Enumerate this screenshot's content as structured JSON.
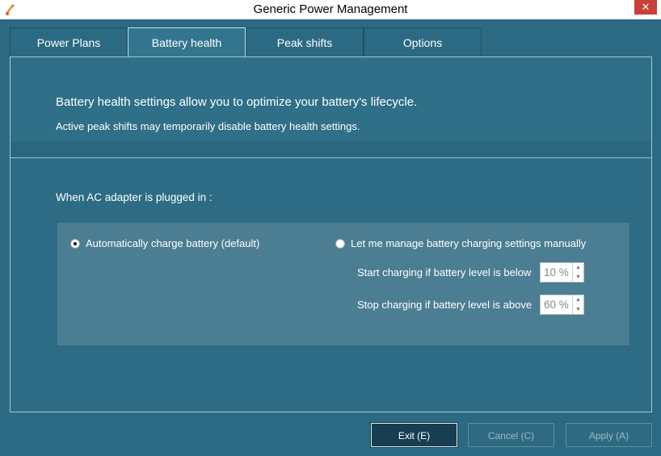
{
  "window": {
    "title": "Generic Power Management",
    "close_glyph": "✕"
  },
  "tabs": [
    {
      "label": "Power Plans"
    },
    {
      "label": "Battery health"
    },
    {
      "label": "Peak shifts"
    },
    {
      "label": "Options"
    }
  ],
  "info": {
    "line1": "Battery health settings allow you to optimize your battery's lifecycle.",
    "line2": "Active peak shifts may temporarily disable battery health settings."
  },
  "ac": {
    "label": "When AC adapter is plugged in :",
    "option_auto": "Automatically charge battery (default)",
    "option_manual": "Let me manage battery charging settings manually",
    "start_label": "Start charging if battery level is below",
    "start_value": "10 %",
    "stop_label": "Stop charging if battery level is above",
    "stop_value": "60 %"
  },
  "buttons": {
    "exit": "Exit (E)",
    "cancel": "Cancel (C)",
    "apply": "Apply (A)"
  }
}
